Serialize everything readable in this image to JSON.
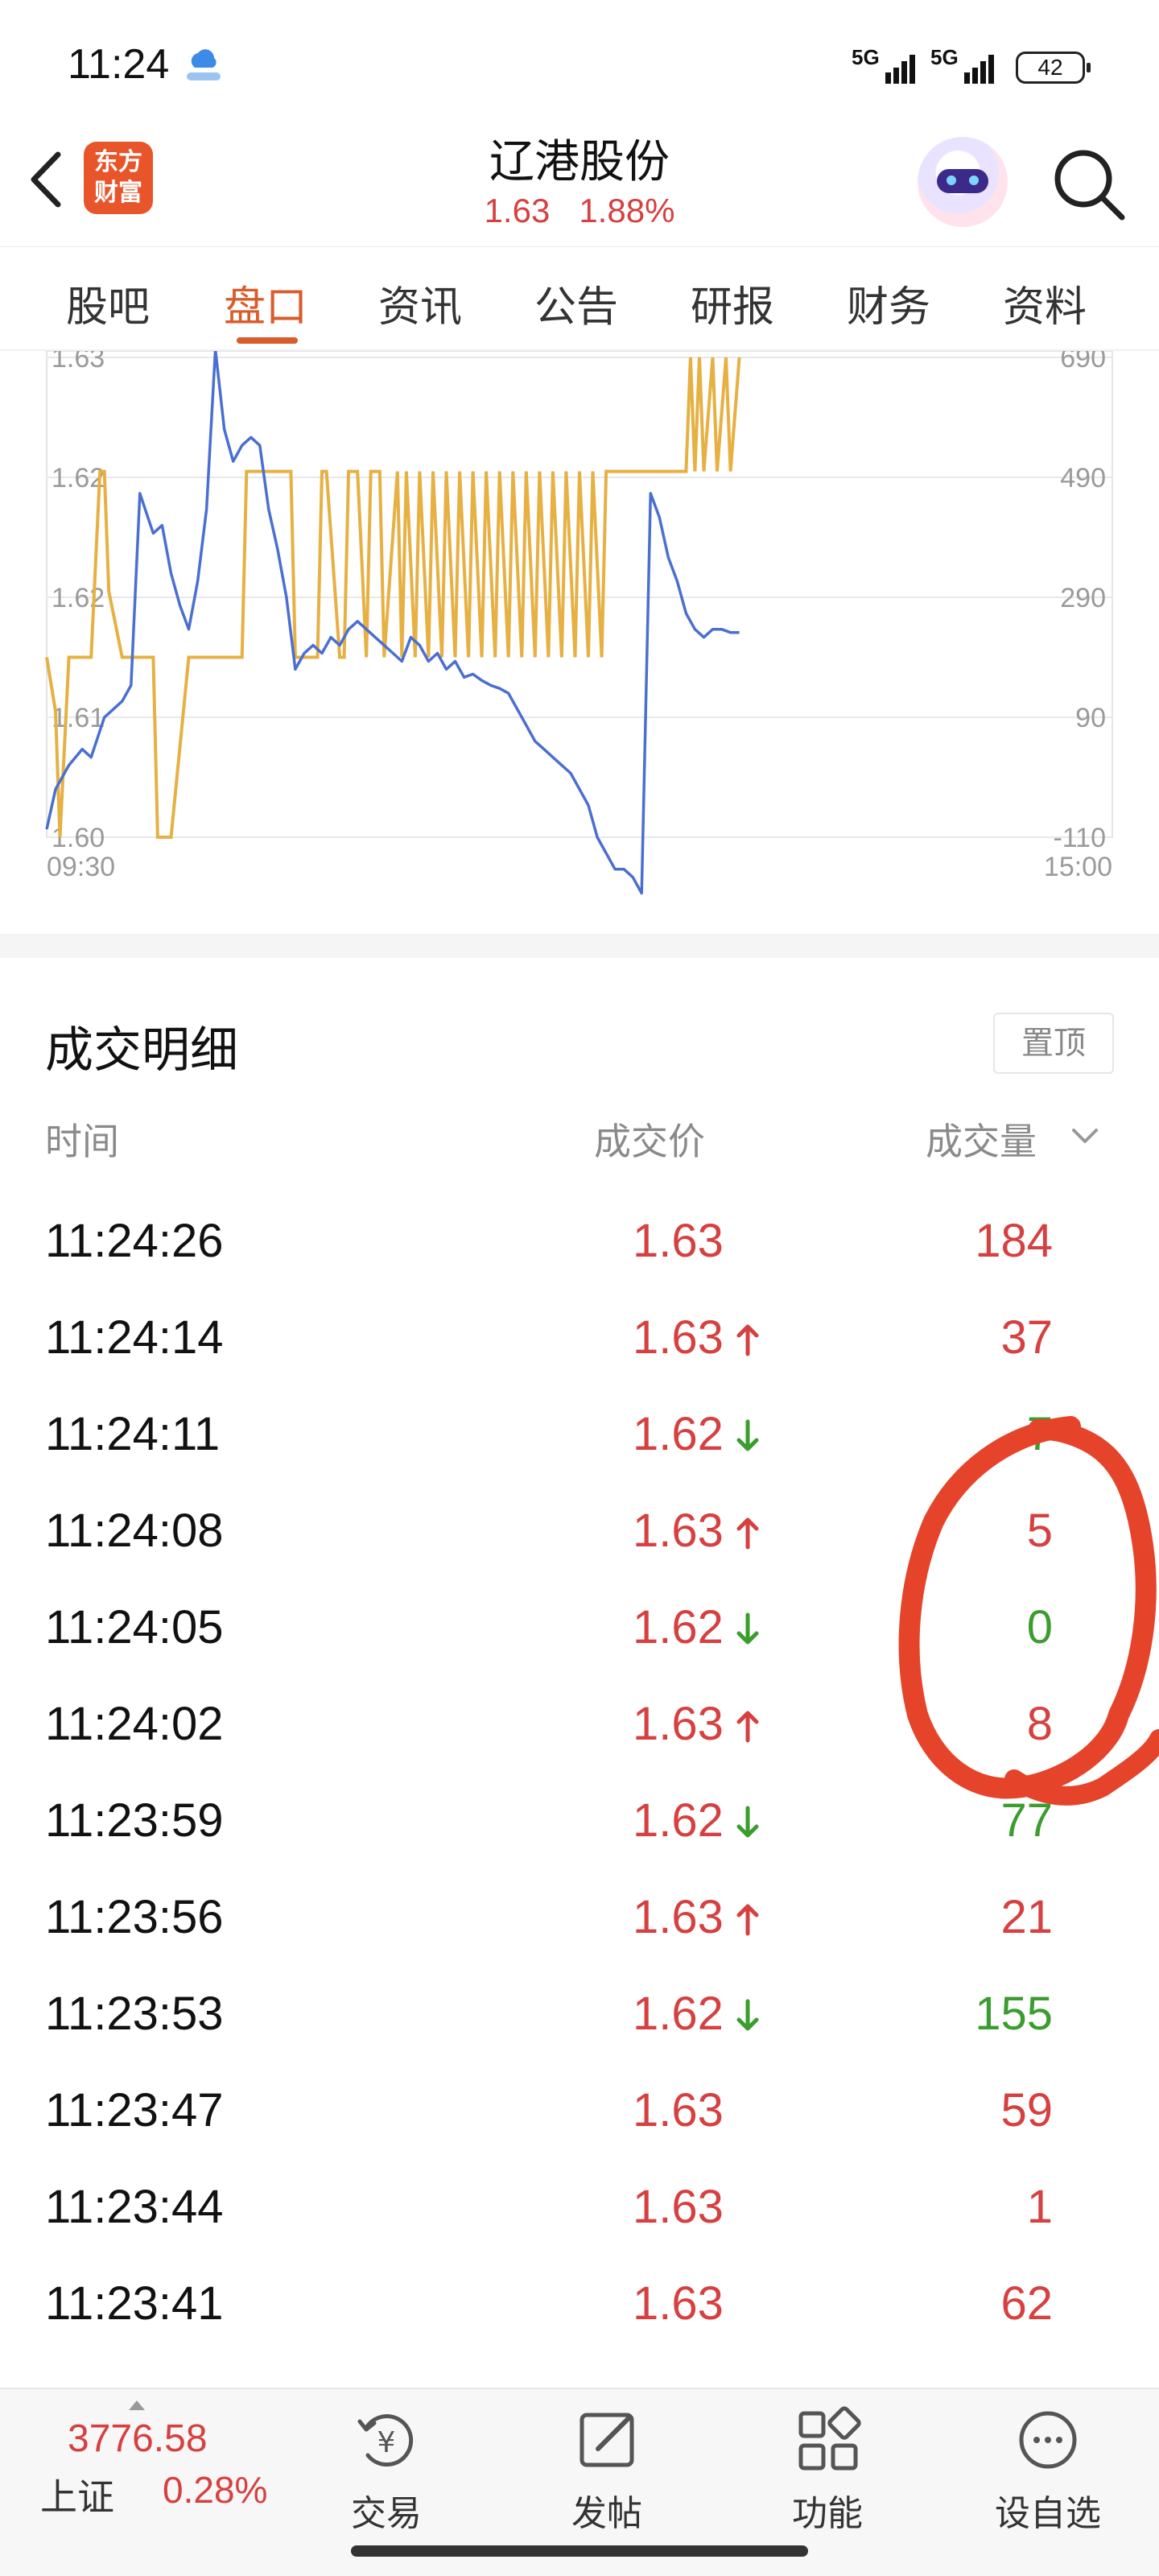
{
  "status_bar": {
    "time": "11:24",
    "net1": "5G",
    "net2": "5G",
    "battery": "42"
  },
  "header": {
    "logo_text": "东方财富",
    "logo_line1": "东方",
    "logo_line2": "财富",
    "stock_name": "辽港股份",
    "price": "1.63",
    "change_pct": "1.88%"
  },
  "tabs": [
    {
      "label": "股吧"
    },
    {
      "label": "盘口",
      "active": true
    },
    {
      "label": "资讯"
    },
    {
      "label": "公告"
    },
    {
      "label": "研报"
    },
    {
      "label": "财务"
    },
    {
      "label": "资料"
    }
  ],
  "chart_data": {
    "type": "line",
    "x_start_label": "09:30",
    "x_end_label": "15:00",
    "left_axis_ticks": [
      "1.63",
      "1.62",
      "1.62",
      "1.61",
      "1.60"
    ],
    "right_axis_ticks": [
      "690",
      "490",
      "290",
      "90",
      "-110"
    ],
    "ylim_left": [
      1.6,
      1.63
    ],
    "ylim_right": [
      -110,
      690
    ],
    "grid": true,
    "series": [
      {
        "color": "#4a6fd0",
        "x": [
          0,
          2,
          5,
          8,
          10,
          13,
          15,
          17,
          19,
          21,
          24,
          26,
          28,
          30,
          32,
          34,
          36,
          38,
          40,
          42,
          44,
          46,
          48,
          50,
          52,
          54,
          56,
          58,
          60,
          62,
          64,
          66,
          68,
          70,
          72,
          74,
          76,
          78,
          80,
          82,
          84,
          86,
          88,
          90,
          92,
          94,
          96,
          98,
          100,
          102,
          104,
          106,
          108,
          110,
          112,
          114,
          116,
          118,
          120,
          122,
          124,
          126,
          128,
          130,
          132,
          134,
          136,
          138,
          140,
          142,
          144,
          146,
          148,
          150,
          152,
          154,
          156
        ],
        "values": [
          1.6005,
          1.603,
          1.6045,
          1.6055,
          1.605,
          1.6075,
          1.608,
          1.6085,
          1.6095,
          1.6215,
          1.619,
          1.6195,
          1.6165,
          1.6145,
          1.613,
          1.616,
          1.6205,
          1.6305,
          1.6255,
          1.6235,
          1.6245,
          1.625,
          1.6245,
          1.6205,
          1.618,
          1.615,
          1.6105,
          1.6115,
          1.612,
          1.6115,
          1.6125,
          1.612,
          1.613,
          1.6135,
          1.613,
          1.6125,
          1.612,
          1.6115,
          1.611,
          1.6125,
          1.612,
          1.611,
          1.6115,
          1.6105,
          1.611,
          1.61,
          1.6102,
          1.6098,
          1.6095,
          1.6093,
          1.609,
          1.608,
          1.607,
          1.606,
          1.6055,
          1.605,
          1.6045,
          1.604,
          1.603,
          1.602,
          1.6,
          1.599,
          1.598,
          1.598,
          1.5975,
          1.5965,
          1.6215,
          1.62,
          1.6175,
          1.616,
          1.614,
          1.613,
          1.6125,
          1.613,
          1.613,
          1.6128,
          1.6128
        ]
      },
      {
        "color": "#e6b042",
        "step": true,
        "x": [
          0,
          2,
          3,
          5,
          10,
          12,
          13,
          14,
          17,
          24,
          25,
          28,
          32,
          33,
          34,
          36,
          37,
          44,
          45,
          47,
          55,
          56,
          60,
          61,
          62,
          63,
          66,
          67,
          68,
          70,
          72,
          73,
          75,
          76,
          79,
          80,
          81,
          83,
          84,
          86,
          87,
          89,
          90,
          92,
          93,
          95,
          96,
          98,
          99,
          101,
          102,
          104,
          105,
          107,
          108,
          110,
          111,
          113,
          114,
          116,
          117,
          119,
          120,
          122,
          123,
          125,
          126,
          127,
          128,
          130,
          131,
          133,
          134,
          135,
          137,
          138,
          140,
          142,
          144,
          145,
          146,
          147,
          148,
          150,
          151,
          153,
          154,
          156
        ],
        "values": [
          190,
          100,
          -110,
          190,
          190,
          500,
          500,
          300,
          190,
          190,
          -110,
          -110,
          190,
          190,
          190,
          190,
          190,
          190,
          500,
          500,
          500,
          190,
          190,
          190,
          500,
          500,
          190,
          190,
          500,
          500,
          190,
          500,
          500,
          190,
          500,
          190,
          500,
          190,
          500,
          190,
          500,
          190,
          500,
          190,
          500,
          190,
          500,
          190,
          500,
          190,
          500,
          190,
          500,
          190,
          500,
          190,
          500,
          190,
          500,
          190,
          500,
          190,
          500,
          190,
          500,
          190,
          500,
          500,
          500,
          500,
          500,
          500,
          500,
          500,
          500,
          500,
          500,
          500,
          500,
          690,
          500,
          690,
          500,
          690,
          500,
          690,
          500,
          690
        ]
      }
    ]
  },
  "trade_detail": {
    "title": "成交明细",
    "pin_label": "置顶",
    "columns": {
      "time": "时间",
      "price": "成交价",
      "volume": "成交量"
    },
    "rows": [
      {
        "time": "11:24:26",
        "price": "1.63",
        "dir": "",
        "volume": "184",
        "vol_color": "red"
      },
      {
        "time": "11:24:14",
        "price": "1.63",
        "dir": "up",
        "volume": "37",
        "vol_color": "red"
      },
      {
        "time": "11:24:11",
        "price": "1.62",
        "dir": "down",
        "volume": "7",
        "vol_color": "green"
      },
      {
        "time": "11:24:08",
        "price": "1.63",
        "dir": "up",
        "volume": "5",
        "vol_color": "red"
      },
      {
        "time": "11:24:05",
        "price": "1.62",
        "dir": "down",
        "volume": "0",
        "vol_color": "green"
      },
      {
        "time": "11:24:02",
        "price": "1.63",
        "dir": "up",
        "volume": "8",
        "vol_color": "red"
      },
      {
        "time": "11:23:59",
        "price": "1.62",
        "dir": "down",
        "volume": "77",
        "vol_color": "green"
      },
      {
        "time": "11:23:56",
        "price": "1.63",
        "dir": "up",
        "volume": "21",
        "vol_color": "red"
      },
      {
        "time": "11:23:53",
        "price": "1.62",
        "dir": "down",
        "volume": "155",
        "vol_color": "green"
      },
      {
        "time": "11:23:47",
        "price": "1.63",
        "dir": "",
        "volume": "59",
        "vol_color": "red"
      },
      {
        "time": "11:23:44",
        "price": "1.63",
        "dir": "",
        "volume": "1",
        "vol_color": "red"
      },
      {
        "time": "11:23:41",
        "price": "1.63",
        "dir": "",
        "volume": "62",
        "vol_color": "red"
      }
    ]
  },
  "bottom_bar": {
    "index_value": "3776.58",
    "index_name": "上证",
    "index_change": "0.28%",
    "nav": [
      {
        "label": "交易",
        "icon": "trade-icon"
      },
      {
        "label": "发帖",
        "icon": "post-icon"
      },
      {
        "label": "功能",
        "icon": "functions-icon"
      },
      {
        "label": "设自选",
        "icon": "watchlist-icon"
      }
    ]
  },
  "colors": {
    "up": "#d64040",
    "down": "#3a9d2e",
    "accent": "#d95c2b",
    "price_line": "#4a6fd0",
    "volume_line": "#e6b042"
  }
}
